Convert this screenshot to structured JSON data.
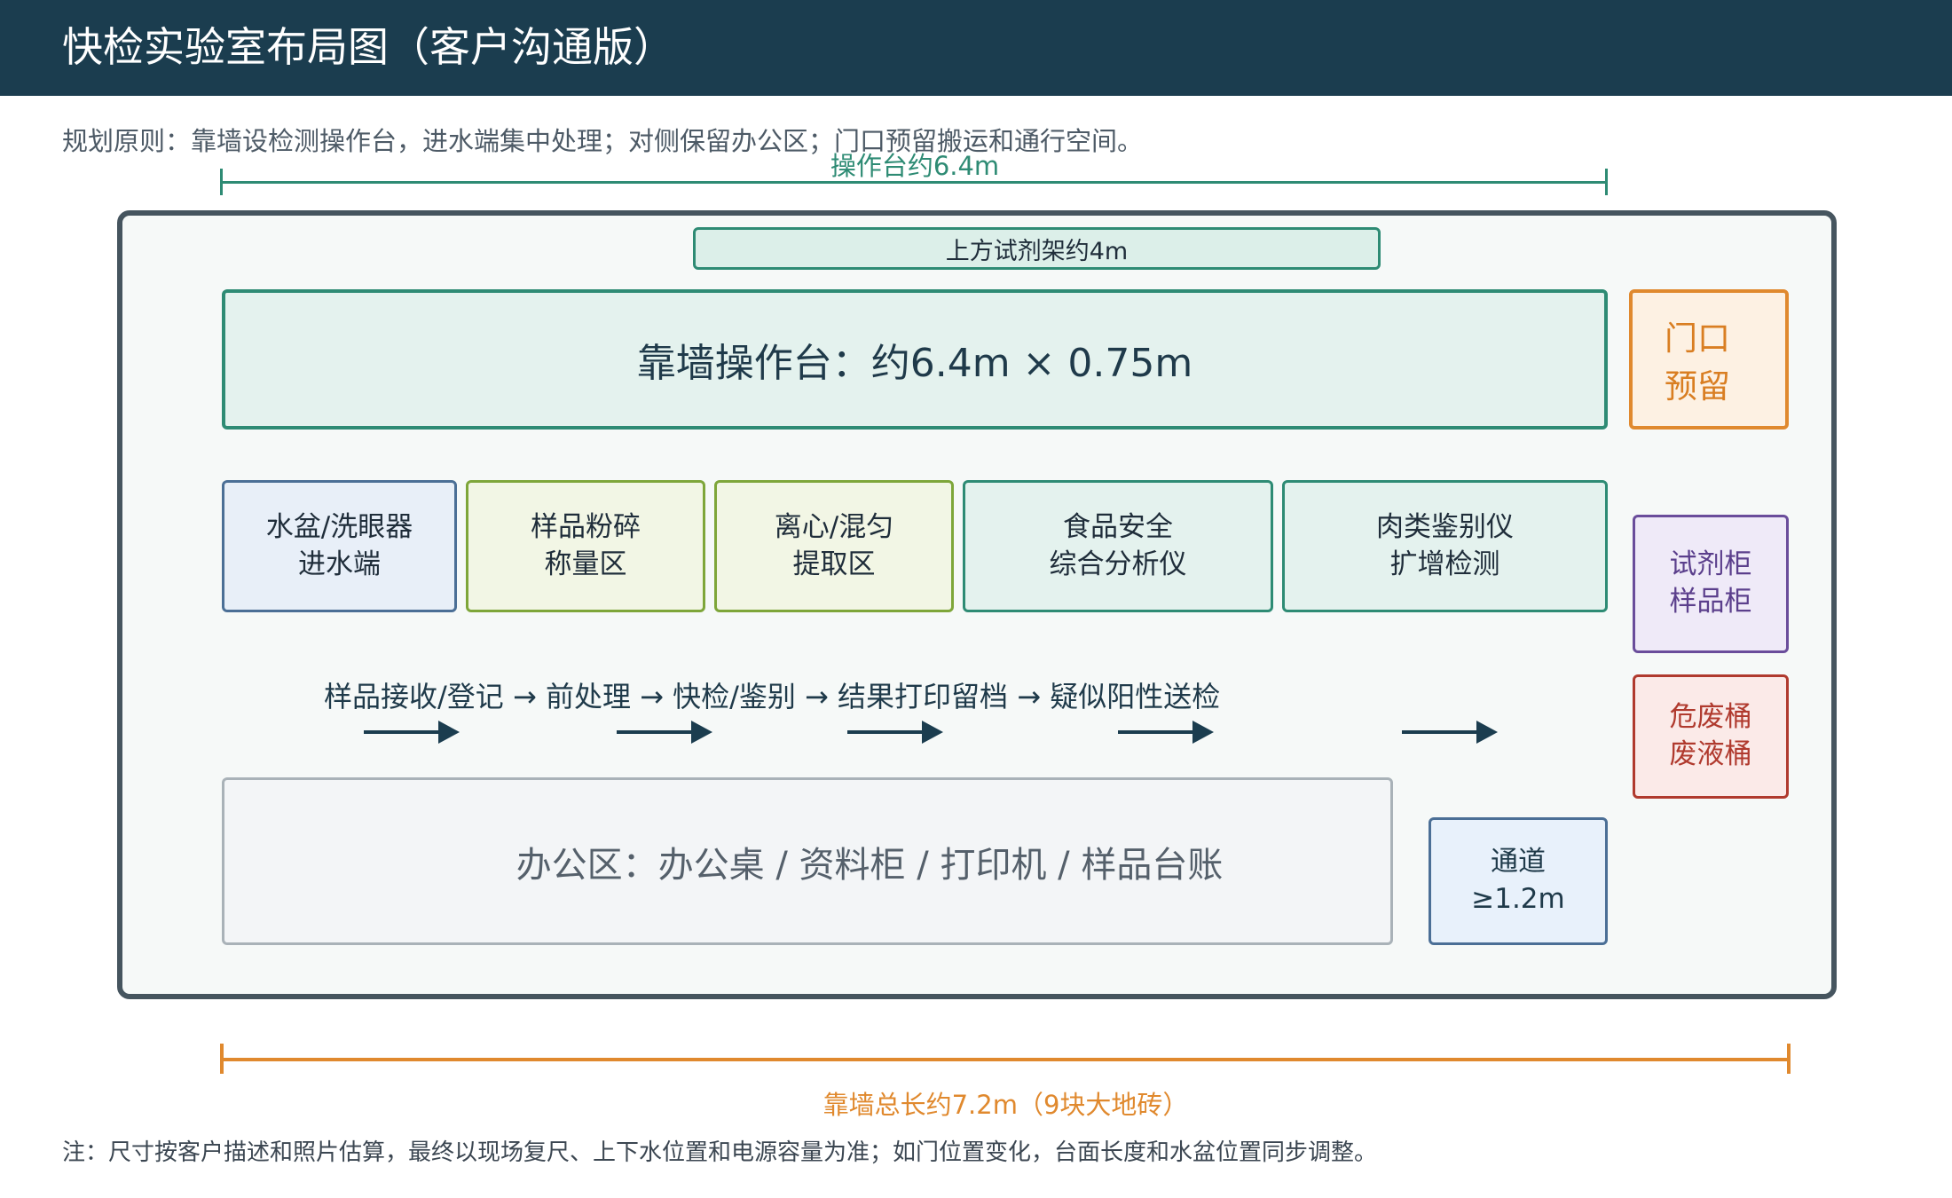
{
  "header": {
    "title": "快检实验室布局图（客户沟通版）"
  },
  "principle": "规划原则：靠墙设检测操作台，进水端集中处理；对侧保留办公区；门口预留搬运和通行空间。",
  "dimensions": {
    "bench_length_label": "操作台约6.4m",
    "wall_length_label": "靠墙总长约7.2m（9块大地砖）"
  },
  "layout": {
    "reagent_rack": "上方试剂架约4m",
    "bench": "靠墙操作台：约6.4m × 0.75m",
    "door": {
      "line1": "门口",
      "line2": "预留"
    },
    "stations": [
      {
        "line1": "水盆/洗眼器",
        "line2": "进水端"
      },
      {
        "line1": "样品粉碎",
        "line2": "称量区"
      },
      {
        "line1": "离心/混匀",
        "line2": "提取区"
      },
      {
        "line1": "食品安全",
        "line2": "综合分析仪"
      },
      {
        "line1": "肉类鉴别仪",
        "line2": "扩增检测"
      }
    ],
    "reagent_cabinet": {
      "line1": "试剂柜",
      "line2": "样品柜"
    },
    "waste_bin": {
      "line1": "危废桶",
      "line2": "废液桶"
    },
    "office": "办公区：办公桌 / 资料柜 / 打印机 / 样品台账",
    "aisle": {
      "line1": "通道",
      "line2": "≥1.2m"
    }
  },
  "workflow": "样品接收/登记 → 前处理 → 快检/鉴别 → 结果打印留档 → 疑似阳性送检",
  "note": "注：尺寸按客户描述和照片估算，最终以现场复尺、上下水位置和电源容量为准；如门位置变化，台面长度和水盆位置同步调整。",
  "colors": {
    "header_bg": "#1b3d4f",
    "bench_green": "#2e8b74",
    "wall_orange": "#e0892e",
    "reagent_purple": "#6a4d9b",
    "waste_red": "#b03a2e",
    "water_blue": "#4b6f96",
    "prep_olive": "#7ea63a"
  }
}
